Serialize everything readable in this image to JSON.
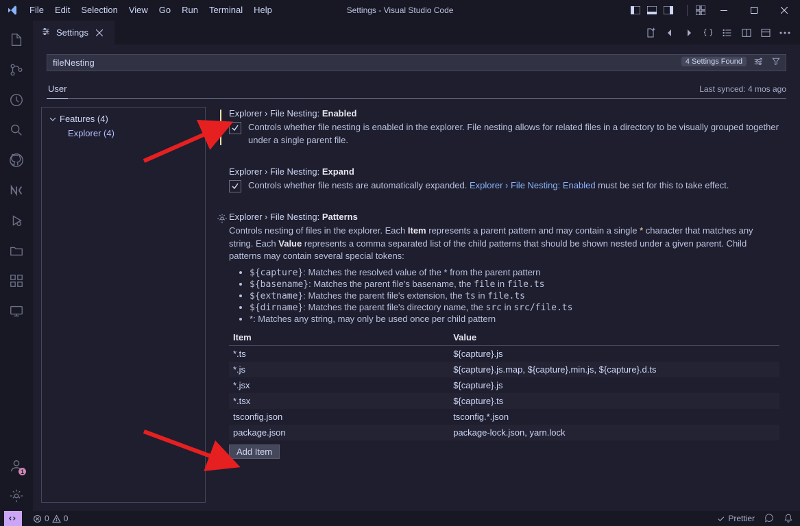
{
  "menu": {
    "file": "File",
    "edit": "Edit",
    "selection": "Selection",
    "view": "View",
    "go": "Go",
    "run": "Run",
    "terminal": "Terminal",
    "help": "Help"
  },
  "window_title": "Settings - Visual Studio Code",
  "tab": {
    "label": "Settings"
  },
  "search": {
    "value": "fileNesting",
    "found_label": "4 Settings Found"
  },
  "scope": {
    "user": "User",
    "sync": "Last synced: 4 mos ago"
  },
  "toc": {
    "features": "Features (4)",
    "explorer": "Explorer (4)"
  },
  "settings": {
    "enabled": {
      "crumb": "Explorer › File Nesting: ",
      "name": "Enabled",
      "desc": "Controls whether file nesting is enabled in the explorer. File nesting allows for related files in a directory to be visually grouped together under a single parent file."
    },
    "expand": {
      "crumb": "Explorer › File Nesting: ",
      "name": "Expand",
      "desc_pre": "Controls whether file nests are automatically expanded. ",
      "link": "Explorer › File Nesting: Enabled",
      "desc_post": " must be set for this to take effect."
    },
    "patterns": {
      "crumb": "Explorer › File Nesting: ",
      "name": "Patterns",
      "desc1_a": "Controls nesting of files in the explorer. Each ",
      "desc1_b": " represents a parent pattern and may contain a single ",
      "desc1_c": " character that matches any string. Each ",
      "desc1_d": " represents a comma separated list of the child patterns that should be shown nested under a given parent. Child patterns may contain several special tokens:",
      "item_word": "Item",
      "value_word": "Value",
      "star": "*",
      "tokens": {
        "capture": "${capture}",
        "capture_txt_a": ": Matches the resolved value of the ",
        "capture_txt_b": " from the parent pattern",
        "basename": "${basename}",
        "basename_txt": ": Matches the parent file's basename, the ",
        "basename_code1": "file",
        "basename_mid": " in ",
        "basename_code2": "file.ts",
        "extname": "${extname}",
        "extname_txt": ": Matches the parent file's extension, the ",
        "extname_code1": "ts",
        "extname_code2": "file.ts",
        "dirname": "${dirname}",
        "dirname_txt": ": Matches the parent file's directory name, the ",
        "dirname_code1": "src",
        "dirname_code2": "src/file.ts",
        "star_txt": ": Matches any string, may only be used once per child pattern"
      },
      "columns": {
        "item": "Item",
        "value": "Value"
      },
      "rows": [
        {
          "item": "*.ts",
          "value": "${capture}.js"
        },
        {
          "item": "*.js",
          "value": "${capture}.js.map, ${capture}.min.js, ${capture}.d.ts"
        },
        {
          "item": "*.jsx",
          "value": "${capture}.js"
        },
        {
          "item": "*.tsx",
          "value": "${capture}.ts"
        },
        {
          "item": "tsconfig.json",
          "value": "tsconfig.*.json"
        },
        {
          "item": "package.json",
          "value": "package-lock.json, yarn.lock"
        }
      ],
      "add_item": "Add Item"
    }
  },
  "statusbar": {
    "errors": "0",
    "warnings": "0",
    "prettier": "Prettier"
  },
  "account_badge": "1"
}
